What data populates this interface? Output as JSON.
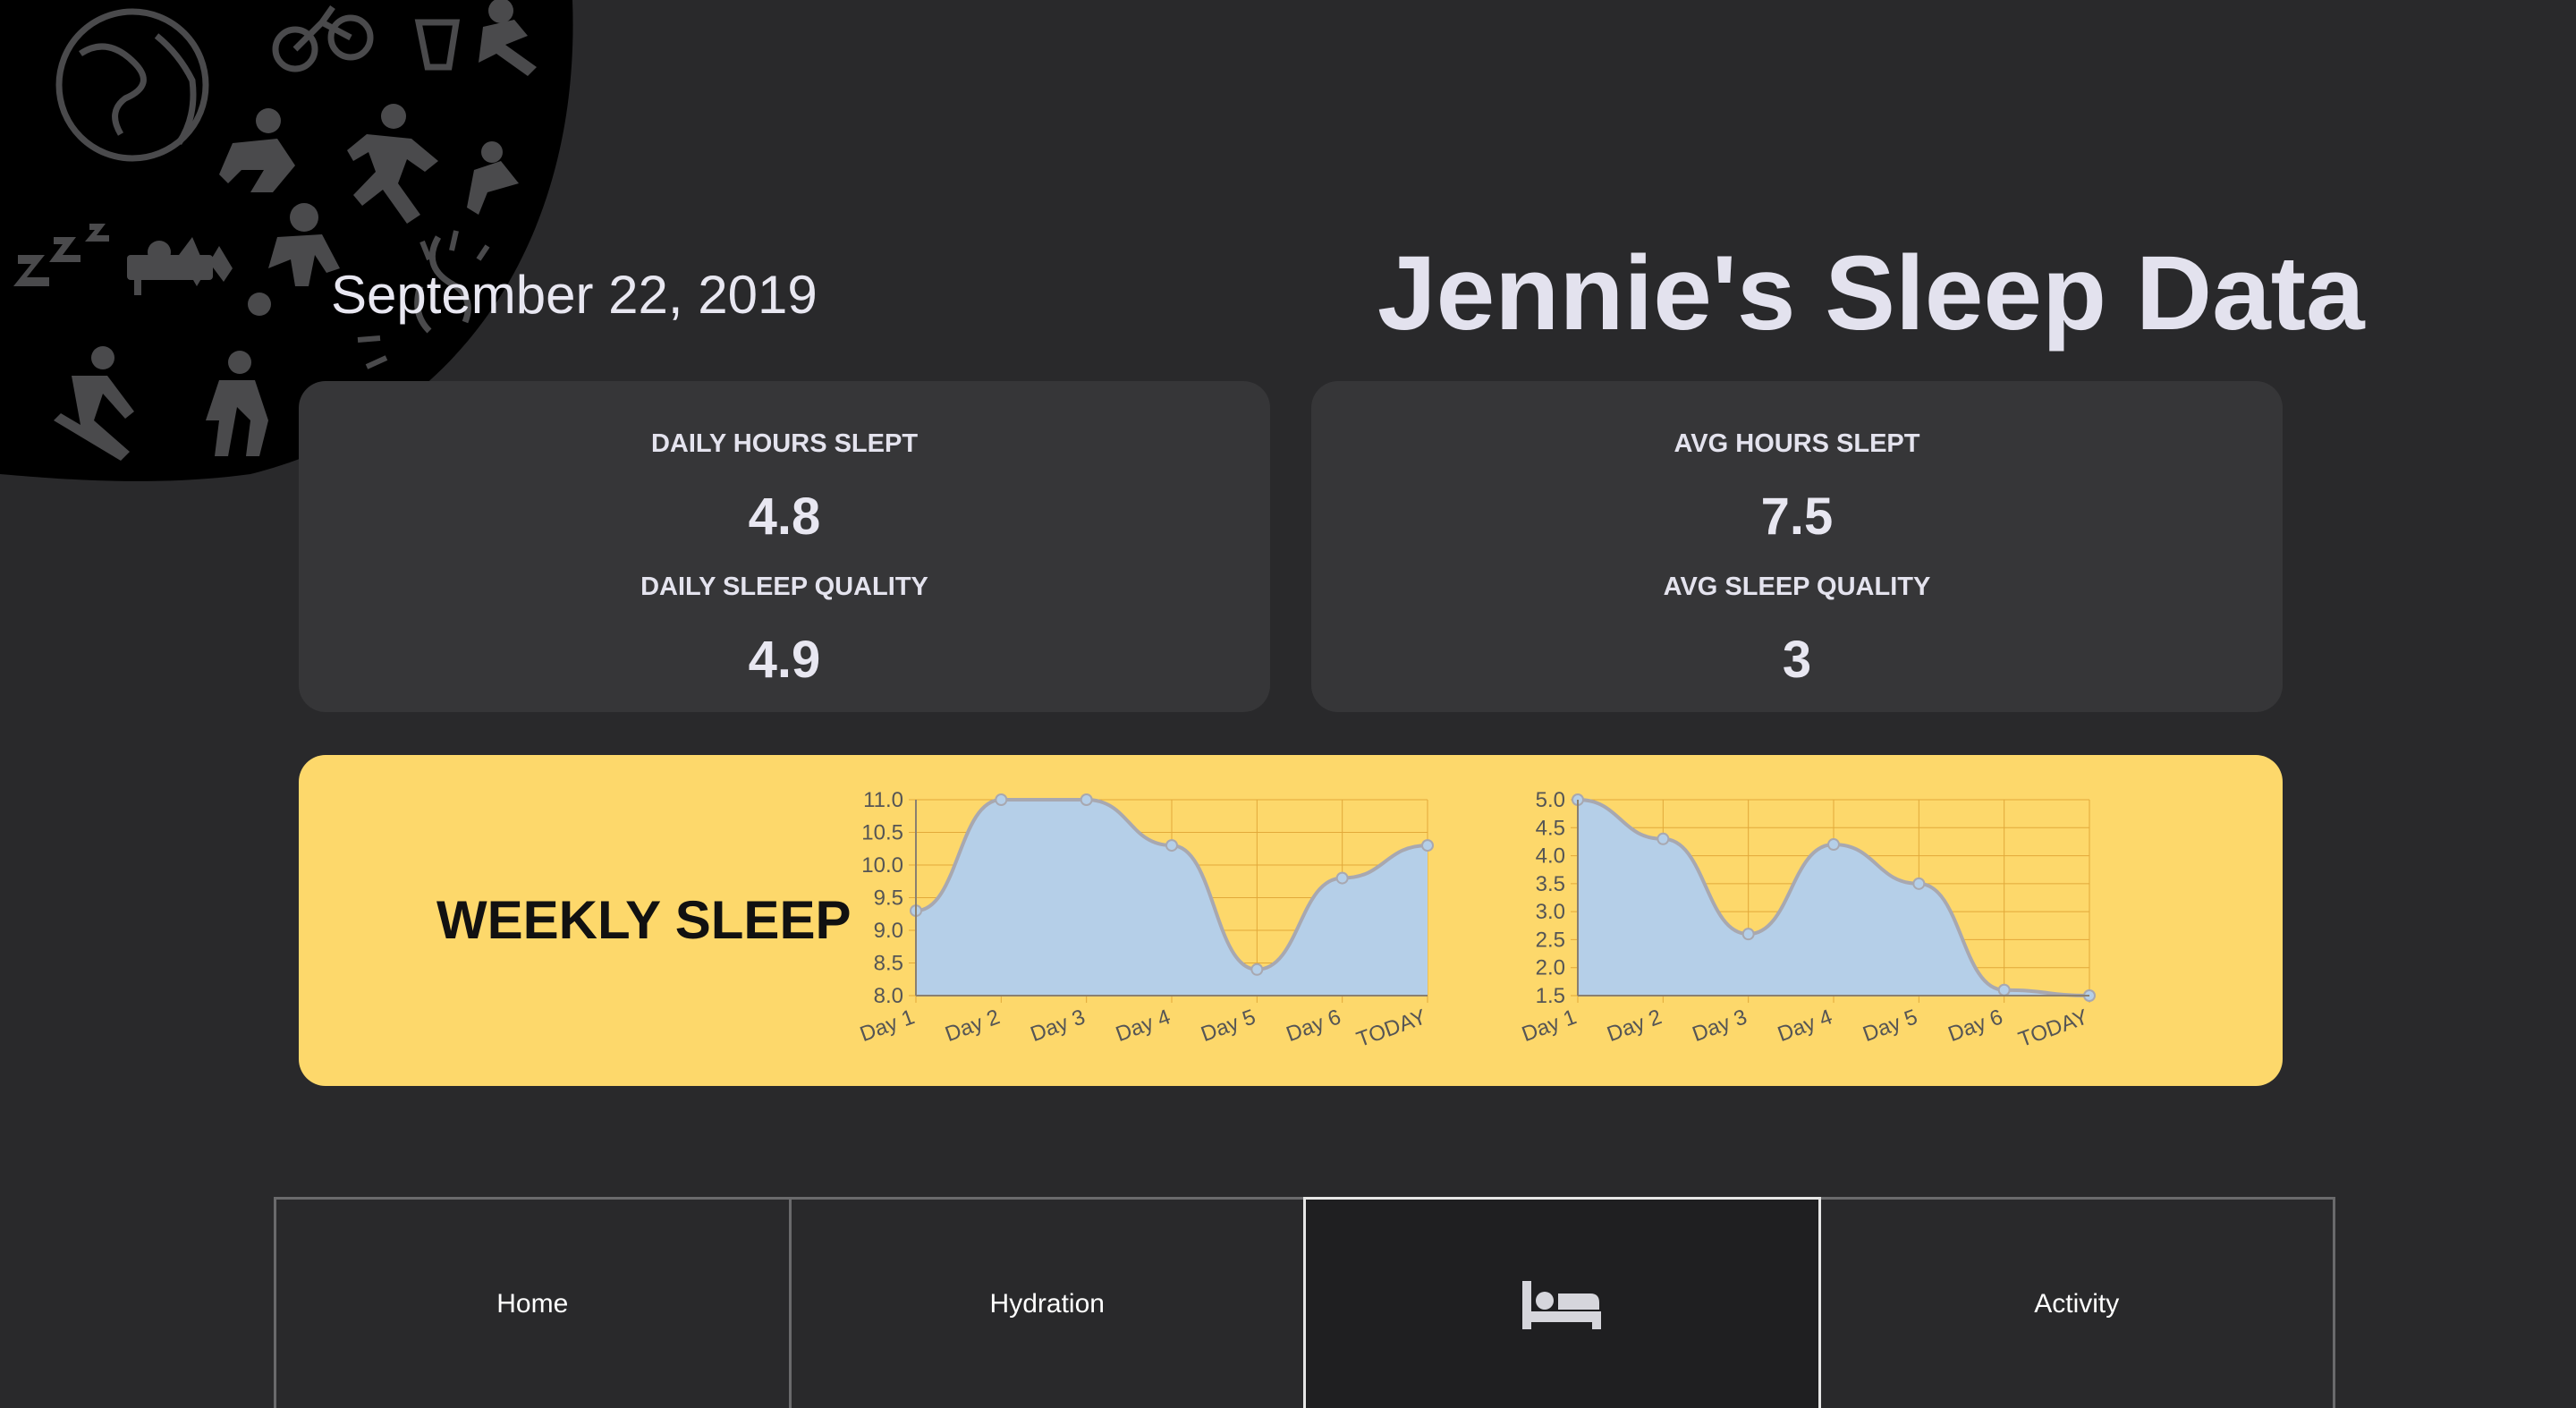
{
  "header": {
    "date": "September 22, 2019",
    "title": "Jennie's Sleep Data"
  },
  "daily_card": {
    "hours_label": "DAILY HOURS SLEPT",
    "hours_value": "4.8",
    "quality_label": "DAILY SLEEP QUALITY",
    "quality_value": "4.9"
  },
  "average_card": {
    "hours_label": "AVG HOURS SLEPT",
    "hours_value": "7.5",
    "quality_label": "AVG SLEEP QUALITY",
    "quality_value": "3"
  },
  "weekly": {
    "title": "WEEKLY SLEEP"
  },
  "colors": {
    "accent": "#fdd86b",
    "card": "#363638",
    "background": "#29292b",
    "area_fill": "#b5cfe8",
    "line": "#a8a8b0",
    "grid": "#e2a93a"
  },
  "chart_data": [
    {
      "type": "area",
      "categories": [
        "Day 1",
        "Day 2",
        "Day 3",
        "Day 4",
        "Day 5",
        "Day 6",
        "TODAY"
      ],
      "values": [
        9.3,
        11.0,
        11.0,
        10.3,
        8.4,
        9.8,
        10.3
      ],
      "yticks": [
        "11.0",
        "10.5",
        "10.0",
        "9.5",
        "9.0",
        "8.5",
        "8.0"
      ],
      "ylim": [
        8.0,
        11.0
      ],
      "grid": true
    },
    {
      "type": "area",
      "categories": [
        "Day 1",
        "Day 2",
        "Day 3",
        "Day 4",
        "Day 5",
        "Day 6",
        "TODAY"
      ],
      "values": [
        5.0,
        4.3,
        2.6,
        4.2,
        3.5,
        1.6,
        1.5
      ],
      "yticks": [
        "5.0",
        "4.5",
        "4.0",
        "3.5",
        "3.0",
        "2.5",
        "2.0",
        "1.5"
      ],
      "ylim": [
        1.5,
        5.0
      ],
      "grid": true
    }
  ],
  "nav": {
    "items": [
      {
        "label": "Home"
      },
      {
        "label": "Hydration"
      },
      {
        "icon": "bed-icon"
      },
      {
        "label": "Activity"
      }
    ]
  }
}
